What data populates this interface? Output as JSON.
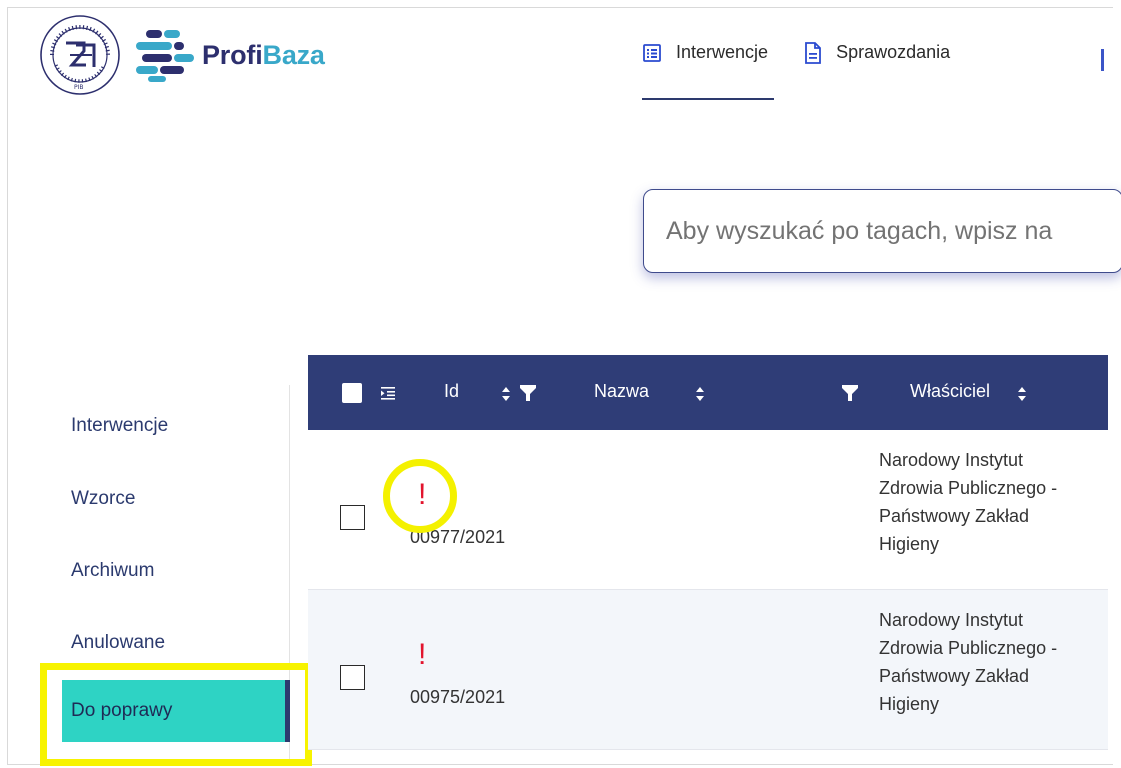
{
  "brand": {
    "name_part1": "Profi",
    "name_part2": "Baza",
    "colors": {
      "dark": "#2d2f6e",
      "light": "#39a8c9",
      "teal": "#2ed3c4"
    }
  },
  "top_nav": {
    "items": [
      {
        "label": "Interwencje",
        "icon": "list-icon",
        "active": true
      },
      {
        "label": "Sprawozdania",
        "icon": "document-icon",
        "active": false
      }
    ]
  },
  "search": {
    "placeholder": "Aby wyszukać po tagach, wpisz na"
  },
  "sidebar": {
    "items": [
      {
        "label": "Interwencje"
      },
      {
        "label": "Wzorce"
      },
      {
        "label": "Archiwum"
      },
      {
        "label": "Anulowane"
      }
    ],
    "active_label": "Do poprawy"
  },
  "table": {
    "columns": {
      "id": "Id",
      "name": "Nazwa",
      "owner": "Właściciel"
    },
    "rows": [
      {
        "flag": "!",
        "id": "00977/2021",
        "owner_lines": [
          "Narodowy Instytut",
          "Zdrowia Publicznego -",
          "Państwowy Zakład",
          "Higieny"
        ]
      },
      {
        "flag": "!",
        "id": "00975/2021",
        "owner_lines": [
          "Narodowy Instytut",
          "Zdrowia Publicznego -",
          "Państwowy Zakład",
          "Higieny"
        ]
      }
    ]
  }
}
